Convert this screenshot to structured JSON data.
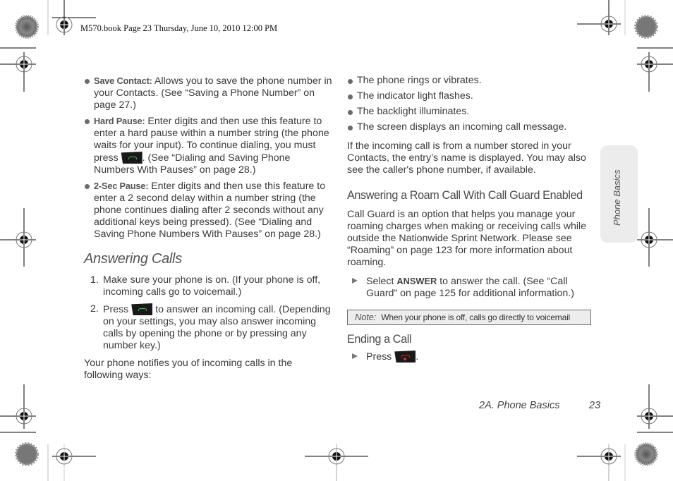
{
  "print_header": "M570.book  Page 23  Thursday, June 10, 2010  12:00 PM",
  "left_column": {
    "bullets": [
      {
        "term": "Save Contact:",
        "text": " Allows you to save the phone number in your Contacts. (See “Saving a Phone Number” on page 27.)"
      },
      {
        "term": "Hard Pause:",
        "text_before_icon": " Enter digits and then use this feature to enter a hard pause within a number string (the phone waits for your input). To continue dialing, you must press ",
        "icon": "talk-key-icon",
        "text_after_icon": ". (See “Dialing and Saving Phone Numbers With Pauses” on page 28.)"
      },
      {
        "term": "2-Sec Pause:",
        "text": " Enter digits and then use this feature to enter a 2 second delay within a number string (the phone continues dialing after 2 seconds without any additional keys being pressed). (See “Dialing and Saving Phone Numbers With Pauses” on page 28.)"
      }
    ],
    "section_title": "Answering Calls",
    "steps": [
      {
        "num": "1.",
        "text": "Make sure your phone is on. (If your phone is off, incoming calls go to voicemail.)"
      },
      {
        "num": "2.",
        "text_before_icon": "Press ",
        "icon": "talk-key-icon",
        "text_after_icon": " to answer an incoming call. (Depending on your settings, you may also answer incoming calls by opening the phone or by pressing any number key.)"
      }
    ],
    "closing_paragraph": "Your phone notifies you of incoming calls in the following ways:"
  },
  "right_column": {
    "bullets": [
      "The phone rings or vibrates.",
      "The indicator light flashes.",
      "The backlight illuminates.",
      "The screen displays an incoming call message."
    ],
    "paragraph": "If the incoming call is from a number stored in your Contacts, the entry’s name is displayed. You may also see the caller's phone number, if available.",
    "roam_heading": "Answering a Roam Call With Call Guard Enabled",
    "roam_paragraph": "Call Guard is an option that helps you manage your roaming charges when making or receiving calls while outside the Nationwide Sprint Network. Please see “Roaming” on page 123 for more information about roaming.",
    "roam_step": {
      "before": "Select ",
      "bold": "ANSWER",
      "after": " to answer the call. (See “Call Guard” on page 125 for additional information.)"
    },
    "note": {
      "label": "Note:",
      "text": "When your phone is off, calls go directly to voicemail"
    },
    "ending_heading": "Ending a Call",
    "ending_step": {
      "before": "Press ",
      "icon": "end-key-icon",
      "after": "."
    }
  },
  "side_tab": "Phone Basics",
  "footer": {
    "section": "2A. Phone Basics",
    "page_number": "23"
  },
  "colors": {
    "talk_key_accent": "#3fc24a",
    "end_key_accent": "#d62a2a",
    "text": "#3a3a3a",
    "note_bg": "#ededed"
  }
}
